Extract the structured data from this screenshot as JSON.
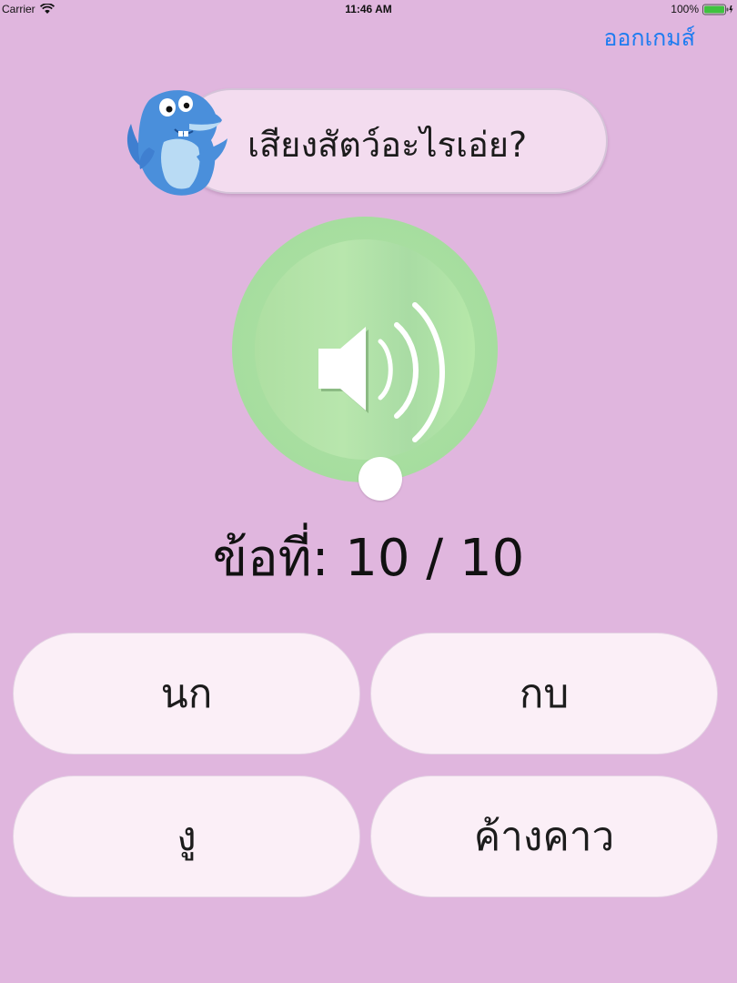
{
  "status_bar": {
    "carrier": "Carrier",
    "time": "11:46 AM",
    "battery": "100%"
  },
  "header": {
    "exit_label": "ออกเกมส์"
  },
  "question": {
    "prompt": "เสียงสัตว์อะไรเอ่ย?"
  },
  "counter": {
    "text": "ข้อที่: 10 / 10"
  },
  "answers": [
    {
      "label": "นก"
    },
    {
      "label": "กบ"
    },
    {
      "label": "งู"
    },
    {
      "label": "ค้างคาว"
    }
  ],
  "icons": {
    "mascot": "dolphin-icon",
    "sound": "speaker-icon"
  },
  "colors": {
    "background": "#e0b6de",
    "link": "#1e7cf0",
    "sound_button": "#aedfa2",
    "answer_button": "#fbeff7",
    "battery": "#3fc23f"
  }
}
